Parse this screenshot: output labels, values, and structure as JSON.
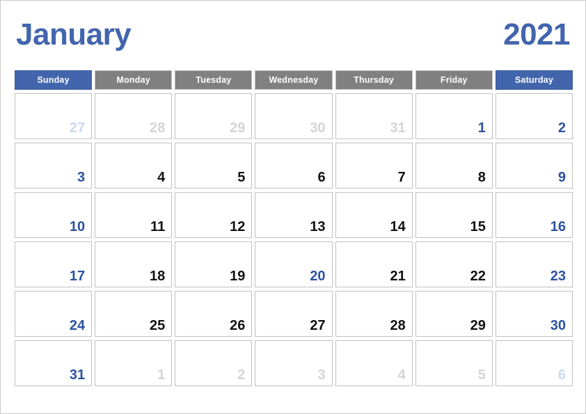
{
  "header": {
    "month": "January",
    "year": "2021"
  },
  "colors": {
    "accent_blue": "#4265ad",
    "date_blue": "#2b52a0",
    "weekday_gray": "#808080",
    "muted_gray": "#d4d4d4",
    "muted_blue": "#ccd8ee",
    "date_black": "#111111",
    "cell_border": "#c0c0c0",
    "page_border": "#c9c9c9"
  },
  "weekdays": [
    {
      "label": "Sunday",
      "highlight": true
    },
    {
      "label": "Monday",
      "highlight": false
    },
    {
      "label": "Tuesday",
      "highlight": false
    },
    {
      "label": "Wednesday",
      "highlight": false
    },
    {
      "label": "Thursday",
      "highlight": false
    },
    {
      "label": "Friday",
      "highlight": false
    },
    {
      "label": "Saturday",
      "highlight": true
    }
  ],
  "weeks": [
    [
      {
        "num": "27",
        "style": "muted-accent"
      },
      {
        "num": "28",
        "style": "muted"
      },
      {
        "num": "29",
        "style": "muted"
      },
      {
        "num": "30",
        "style": "muted"
      },
      {
        "num": "31",
        "style": "muted"
      },
      {
        "num": "1",
        "style": "accent"
      },
      {
        "num": "2",
        "style": "accent"
      }
    ],
    [
      {
        "num": "3",
        "style": "accent"
      },
      {
        "num": "4",
        "style": "normal"
      },
      {
        "num": "5",
        "style": "normal"
      },
      {
        "num": "6",
        "style": "normal"
      },
      {
        "num": "7",
        "style": "normal"
      },
      {
        "num": "8",
        "style": "normal"
      },
      {
        "num": "9",
        "style": "accent"
      }
    ],
    [
      {
        "num": "10",
        "style": "accent"
      },
      {
        "num": "11",
        "style": "normal"
      },
      {
        "num": "12",
        "style": "normal"
      },
      {
        "num": "13",
        "style": "normal"
      },
      {
        "num": "14",
        "style": "normal"
      },
      {
        "num": "15",
        "style": "normal"
      },
      {
        "num": "16",
        "style": "accent"
      }
    ],
    [
      {
        "num": "17",
        "style": "accent"
      },
      {
        "num": "18",
        "style": "normal"
      },
      {
        "num": "19",
        "style": "normal"
      },
      {
        "num": "20",
        "style": "accent"
      },
      {
        "num": "21",
        "style": "normal"
      },
      {
        "num": "22",
        "style": "normal"
      },
      {
        "num": "23",
        "style": "accent"
      }
    ],
    [
      {
        "num": "24",
        "style": "accent"
      },
      {
        "num": "25",
        "style": "normal"
      },
      {
        "num": "26",
        "style": "normal"
      },
      {
        "num": "27",
        "style": "normal"
      },
      {
        "num": "28",
        "style": "normal"
      },
      {
        "num": "29",
        "style": "normal"
      },
      {
        "num": "30",
        "style": "accent"
      }
    ],
    [
      {
        "num": "31",
        "style": "accent"
      },
      {
        "num": "1",
        "style": "muted"
      },
      {
        "num": "2",
        "style": "muted"
      },
      {
        "num": "3",
        "style": "muted"
      },
      {
        "num": "4",
        "style": "muted"
      },
      {
        "num": "5",
        "style": "muted"
      },
      {
        "num": "6",
        "style": "muted-accent"
      }
    ]
  ]
}
